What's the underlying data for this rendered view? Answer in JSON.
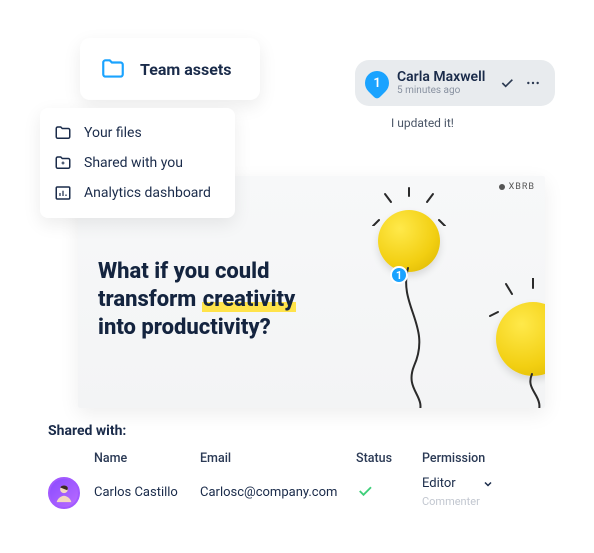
{
  "nav": {
    "header": "Team assets",
    "items": [
      {
        "label": "Your files"
      },
      {
        "label": "Shared with you"
      },
      {
        "label": "Analytics dashboard"
      }
    ]
  },
  "comment": {
    "marker": "1",
    "author": "Carla Maxwell",
    "timestamp": "5 minutes ago",
    "body": "I updated it!"
  },
  "slide": {
    "brand": "XBRB",
    "hero_line1": "What if you could",
    "hero_line2a": "transform ",
    "hero_highlight": "creativity",
    "hero_line3": "into productivity?",
    "marker": "1"
  },
  "share": {
    "heading": "Shared with:",
    "columns": {
      "name": "Name",
      "email": "Email",
      "status": "Status",
      "permission": "Permission"
    },
    "rows": [
      {
        "name": "Carlos Castillo",
        "email": "Carlosc@company.com",
        "status": "ok",
        "permission": "Editor",
        "permission_alt": "Commenter"
      }
    ]
  }
}
